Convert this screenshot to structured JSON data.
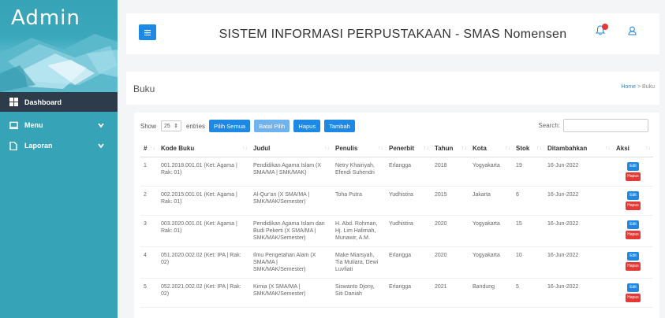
{
  "sidebar": {
    "brand": "Admin",
    "items": [
      {
        "label": "Dashboard",
        "icon": "dashboard-icon"
      },
      {
        "label": "Menu",
        "icon": "monitor-icon"
      },
      {
        "label": "Laporan",
        "icon": "document-icon"
      }
    ]
  },
  "header": {
    "title": "SISTEM INFORMASI PERPUSTAKAAN - SMAS Nomensen"
  },
  "breadcrumb": {
    "title": "Buku",
    "home": "Home",
    "separator": ">",
    "current": "Buku"
  },
  "toolbar": {
    "show": "Show",
    "entries_value": "25",
    "entries": "entries",
    "pilih_semua": "Pilih Semua",
    "batal_pilih": "Batal Pilih",
    "hapus": "Hapus",
    "tambah": "Tambah",
    "search_label": "Search:"
  },
  "table": {
    "columns": [
      "#",
      "Kode Buku",
      "Judul",
      "Penulis",
      "Penerbit",
      "Tahun",
      "Kota",
      "Stok",
      "Ditambahkan",
      "Aksi"
    ],
    "edit_label": "Edit",
    "hapus_label": "Hapus",
    "rows": [
      {
        "no": "1",
        "kode": "001.2018.001.01 (Ket: Agama | Rak: 01)",
        "judul": "Pendidikan Agama Islam (X SMA/MA | SMK/MAK)",
        "penulis": "Netry Khairiyah, Efendi Suhendri",
        "penerbit": "Erlangga",
        "tahun": "2018",
        "kota": "Yogyakarta",
        "stok": "19",
        "tanggal": "16-Jun-2022"
      },
      {
        "no": "2",
        "kode": "002.2015.001.01 (Ket: Agama | Rak: 01)",
        "judul": "Al-Qur'an (X SMA/MA | SMK/MAK/Semester)",
        "penulis": "Toha Putra",
        "penerbit": "Yudhistira",
        "tahun": "2015",
        "kota": "Jakarta",
        "stok": "6",
        "tanggal": "16-Jun-2022"
      },
      {
        "no": "3",
        "kode": "003.2020.001.01 (Ket: Agama | Rak: 01)",
        "judul": "Pendidikan Agama Islam dan Budi Pekerti (X SMA/MA | SMK/MAK/Semester)",
        "penulis": "H. Abd. Rohman, Hj. Lim Halimah, Munawir, A.M.",
        "penerbit": "Yudhistira",
        "tahun": "2020",
        "kota": "Yogyakarta",
        "stok": "15",
        "tanggal": "16-Jun-2022"
      },
      {
        "no": "4",
        "kode": "051.2020.002.02 (Ket: IPA | Rak: 02)",
        "judul": "Ilmu Pengetahan Alam (X SMA/MA | SMK/MAK/Semester)",
        "penulis": "Make Miarsyah, Tia Mutiara, Dewi Luvfiati",
        "penerbit": "Erlangga",
        "tahun": "2020",
        "kota": "Yogyakarta",
        "stok": "10",
        "tanggal": "16-Jun-2022"
      },
      {
        "no": "5",
        "kode": "052.2021.002.02 (Ket: IPA | Rak: 02)",
        "judul": "Kimia (X SMA/MA | SMK/MAK/Semester)",
        "penulis": "Siswanto Djony, Siti Daniah",
        "penerbit": "Erlangga",
        "tahun": "2021",
        "kota": "Bandung",
        "stok": "5",
        "tanggal": "16-Jun-2022"
      }
    ]
  },
  "colors": {
    "sidebar": "#36a3b6",
    "primary": "#1e88e5",
    "danger": "#e53935",
    "active_nav": "#2d3b4a"
  }
}
